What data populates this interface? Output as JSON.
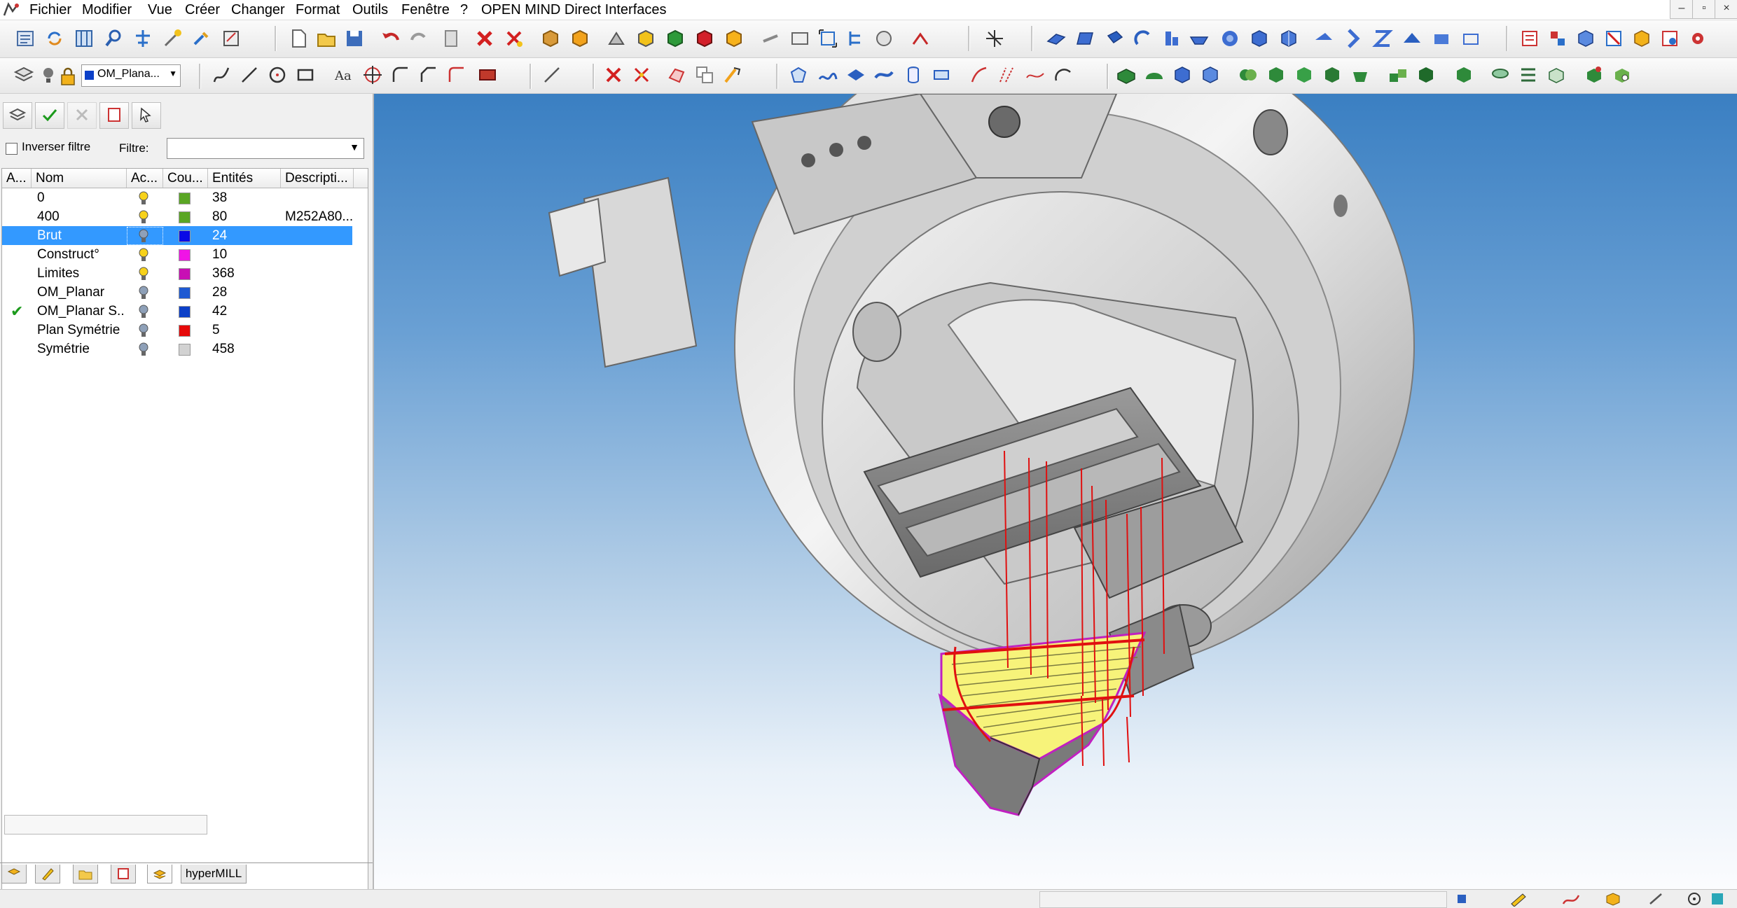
{
  "app": {
    "title": "OPEN MIND Direct Interfaces",
    "menu": [
      "Fichier",
      "Modifier",
      "Vue",
      "Créer",
      "Changer",
      "Format",
      "Outils",
      "Fenêtre",
      "?"
    ],
    "window_buttons": [
      "–",
      "▫",
      "×"
    ]
  },
  "toolbar": {
    "layer_combo_value": "OM_Plana...",
    "layer_combo_color": "#0c40c8"
  },
  "layers_panel": {
    "invert_filter_label": "Inverser filtre",
    "filter_label": "Filtre:",
    "filter_value": "",
    "columns": [
      "A...",
      "Nom",
      "Ac...",
      "Cou...",
      "Entités",
      "Descripti..."
    ],
    "rows": [
      {
        "active": false,
        "name": "0",
        "lamp": "on",
        "color": "#5aa624",
        "entities": "38",
        "description": "",
        "selected": false
      },
      {
        "active": false,
        "name": "400",
        "lamp": "on",
        "color": "#5aa624",
        "entities": "80",
        "description": "M252A80...",
        "selected": false
      },
      {
        "active": false,
        "name": "Brut",
        "lamp": "off",
        "color": "#0a0ae6",
        "entities": "24",
        "description": "",
        "selected": true
      },
      {
        "active": false,
        "name": "Construct°",
        "lamp": "on",
        "color": "#f014e6",
        "entities": "10",
        "description": "",
        "selected": false
      },
      {
        "active": false,
        "name": "Limites",
        "lamp": "on",
        "color": "#c80fb4",
        "entities": "368",
        "description": "",
        "selected": false
      },
      {
        "active": false,
        "name": "OM_Planar",
        "lamp": "off",
        "color": "#1e5ad2",
        "entities": "28",
        "description": "",
        "selected": false
      },
      {
        "active": true,
        "name": "OM_Planar S...",
        "lamp": "off",
        "color": "#0c40c8",
        "entities": "42",
        "description": "",
        "selected": false
      },
      {
        "active": false,
        "name": "Plan Symétrie",
        "lamp": "off",
        "color": "#e60a0a",
        "entities": "5",
        "description": "",
        "selected": false
      },
      {
        "active": false,
        "name": "Symétrie",
        "lamp": "off",
        "color": "#d2d2d2",
        "entities": "458",
        "description": "",
        "selected": false
      }
    ],
    "bottom_field_value": "",
    "bottom_tabs": [
      "layers-tab",
      "sketch-tab",
      "folder-tab",
      "stop-tab",
      "layer-stack-tab"
    ],
    "hypermill_tab": "hyperMILL"
  }
}
